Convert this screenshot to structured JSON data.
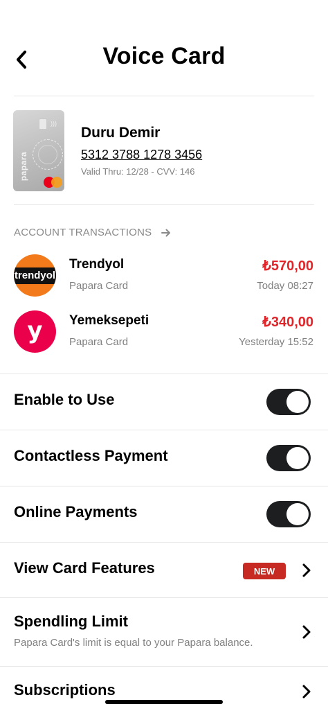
{
  "header": {
    "title": "Voice Card"
  },
  "card": {
    "brand_text": "papara",
    "holder_name": "Duru Demir",
    "number": "5312 3788 1278 3456",
    "meta": "Valid Thru: 12/28  -  CVV: 146"
  },
  "transactions": {
    "section_title": "ACCOUNT TRANSACTIONS",
    "items": [
      {
        "merchant": "Trendyol",
        "logo_text": "trendyol",
        "source": "Papara Card",
        "amount": "₺570,00",
        "time": "Today 08:27",
        "logo_color": "#f27a1a"
      },
      {
        "merchant": "Yemeksepeti",
        "logo_text": "y",
        "source": "Papara Card",
        "amount": "₺340,00",
        "time": "Yesterday 15:52",
        "logo_color": "#ea004b"
      }
    ]
  },
  "settings": {
    "enable_to_use": {
      "label": "Enable to Use",
      "on": true
    },
    "contactless": {
      "label": "Contactless Payment",
      "on": true
    },
    "online": {
      "label": "Online Payments",
      "on": true
    },
    "features": {
      "label": "View Card Features",
      "badge": "NEW"
    },
    "limit": {
      "label": "Spendling Limit",
      "sub": "Papara Card's limit is equal to your Papara balance."
    },
    "subscriptions": {
      "label": "Subscriptions"
    }
  },
  "colors": {
    "amount": "#e0262b",
    "badge": "#c62a22",
    "toggle_on": "#1c1e1f"
  },
  "icons": {
    "back": "chevron-left-icon",
    "arrow": "arrow-right-icon",
    "chevron": "chevron-right-icon"
  }
}
